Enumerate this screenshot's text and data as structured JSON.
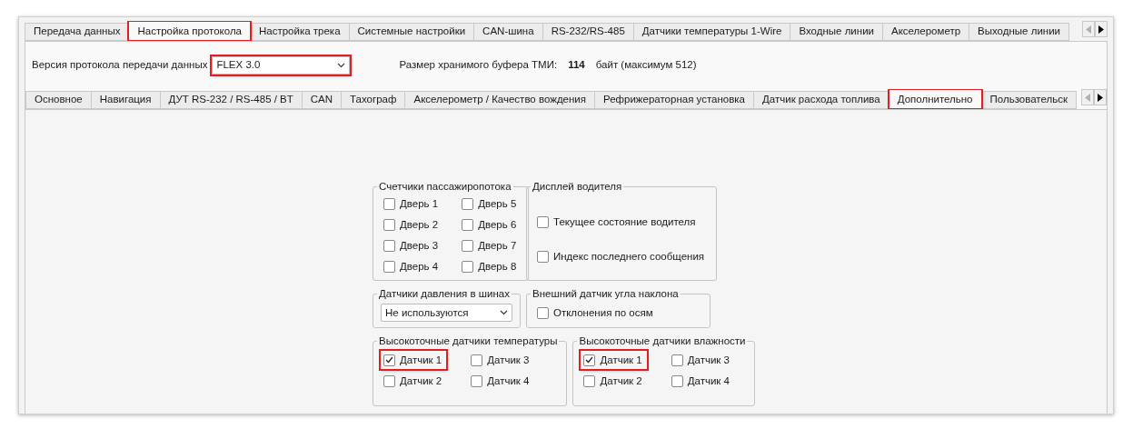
{
  "top_tabs": [
    {
      "label": "Передача данных",
      "selected": false,
      "highlighted": false
    },
    {
      "label": "Настройка протокола",
      "selected": true,
      "highlighted": true
    },
    {
      "label": "Настройка трека",
      "selected": false,
      "highlighted": false
    },
    {
      "label": "Системные настройки",
      "selected": false,
      "highlighted": false
    },
    {
      "label": "CAN-шина",
      "selected": false,
      "highlighted": false
    },
    {
      "label": "RS-232/RS-485",
      "selected": false,
      "highlighted": false
    },
    {
      "label": "Датчики температуры 1-Wire",
      "selected": false,
      "highlighted": false
    },
    {
      "label": "Входные линии",
      "selected": false,
      "highlighted": false
    },
    {
      "label": "Акселерометр",
      "selected": false,
      "highlighted": false
    },
    {
      "label": "Выходные линии",
      "selected": false,
      "highlighted": false
    }
  ],
  "protocol": {
    "label": "Версия протокола передачи данных",
    "value": "FLEX 3.0",
    "highlighted": true
  },
  "buffer": {
    "label": "Размер хранимого буфера ТМИ:",
    "value": "114",
    "unit": "байт (максимум 512)"
  },
  "sub_tabs": [
    {
      "label": "Основное",
      "selected": false,
      "highlighted": false
    },
    {
      "label": "Навигация",
      "selected": false,
      "highlighted": false
    },
    {
      "label": "ДУТ RS-232 / RS-485 / BT",
      "selected": false,
      "highlighted": false
    },
    {
      "label": "CAN",
      "selected": false,
      "highlighted": false
    },
    {
      "label": "Тахограф",
      "selected": false,
      "highlighted": false
    },
    {
      "label": "Акселерометр / Качество вождения",
      "selected": false,
      "highlighted": false
    },
    {
      "label": "Рефрижераторная установка",
      "selected": false,
      "highlighted": false
    },
    {
      "label": "Датчик расхода топлива",
      "selected": false,
      "highlighted": false
    },
    {
      "label": "Дополнительно",
      "selected": true,
      "highlighted": true
    },
    {
      "label": "Пользовательск",
      "selected": false,
      "highlighted": false
    }
  ],
  "passenger_counters": {
    "title": "Счетчики пассажиропотока",
    "items": [
      {
        "label": "Дверь 1",
        "checked": false
      },
      {
        "label": "Дверь 2",
        "checked": false
      },
      {
        "label": "Дверь 3",
        "checked": false
      },
      {
        "label": "Дверь 4",
        "checked": false
      },
      {
        "label": "Дверь 5",
        "checked": false
      },
      {
        "label": "Дверь 6",
        "checked": false
      },
      {
        "label": "Дверь 7",
        "checked": false
      },
      {
        "label": "Дверь 8",
        "checked": false
      }
    ]
  },
  "driver_display": {
    "title": "Дисплей водителя",
    "items": [
      {
        "label": "Текущее состояние водителя",
        "checked": false
      },
      {
        "label": "Индекс последнего сообщения",
        "checked": false
      }
    ]
  },
  "tire_pressure": {
    "title": "Датчики давления в шинах",
    "value": "Не используются"
  },
  "tilt_sensor": {
    "title": "Внешний датчик угла наклона",
    "items": [
      {
        "label": "Отклонения по осям",
        "checked": false
      }
    ]
  },
  "temperature_sensors": {
    "title": "Высокоточные датчики температуры",
    "items": [
      {
        "label": "Датчик 1",
        "checked": true,
        "highlighted": true
      },
      {
        "label": "Датчик 2",
        "checked": false,
        "highlighted": false
      },
      {
        "label": "Датчик 3",
        "checked": false,
        "highlighted": false
      },
      {
        "label": "Датчик 4",
        "checked": false,
        "highlighted": false
      }
    ]
  },
  "humidity_sensors": {
    "title": "Высокоточные датчики влажности",
    "items": [
      {
        "label": "Датчик 1",
        "checked": true,
        "highlighted": true
      },
      {
        "label": "Датчик 2",
        "checked": false,
        "highlighted": false
      },
      {
        "label": "Датчик 3",
        "checked": false,
        "highlighted": false
      },
      {
        "label": "Датчик 4",
        "checked": false,
        "highlighted": false
      }
    ]
  }
}
